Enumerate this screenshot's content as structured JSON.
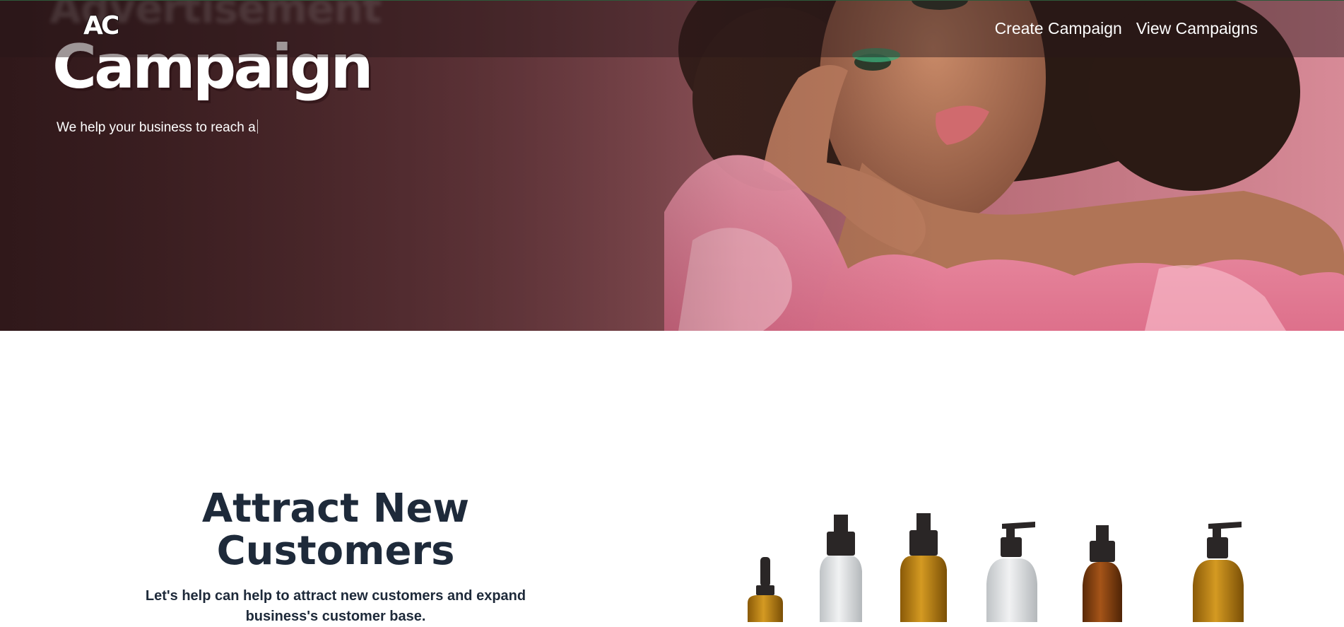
{
  "navbar": {
    "logo_text": "AC",
    "links": [
      {
        "label": "Create Campaign"
      },
      {
        "label": "View Campaigns"
      }
    ]
  },
  "hero": {
    "ghost_text": "Advertisement",
    "title": "Campaign",
    "typed_text": "We help your business to reach a"
  },
  "section": {
    "title": "Attract New Customers",
    "description": "Let's help can help to attract new customers and expand business's customer base."
  },
  "colors": {
    "hero_gradient_start": "#3f2426",
    "hero_gradient_end": "#d78a97",
    "heading_text": "#1e2a3a",
    "nav_text": "#ffffff"
  },
  "icons": {
    "logo": "ac-logo",
    "hero_image": "model-portrait-photo",
    "product_image": "cosmetic-bottles-photo"
  }
}
